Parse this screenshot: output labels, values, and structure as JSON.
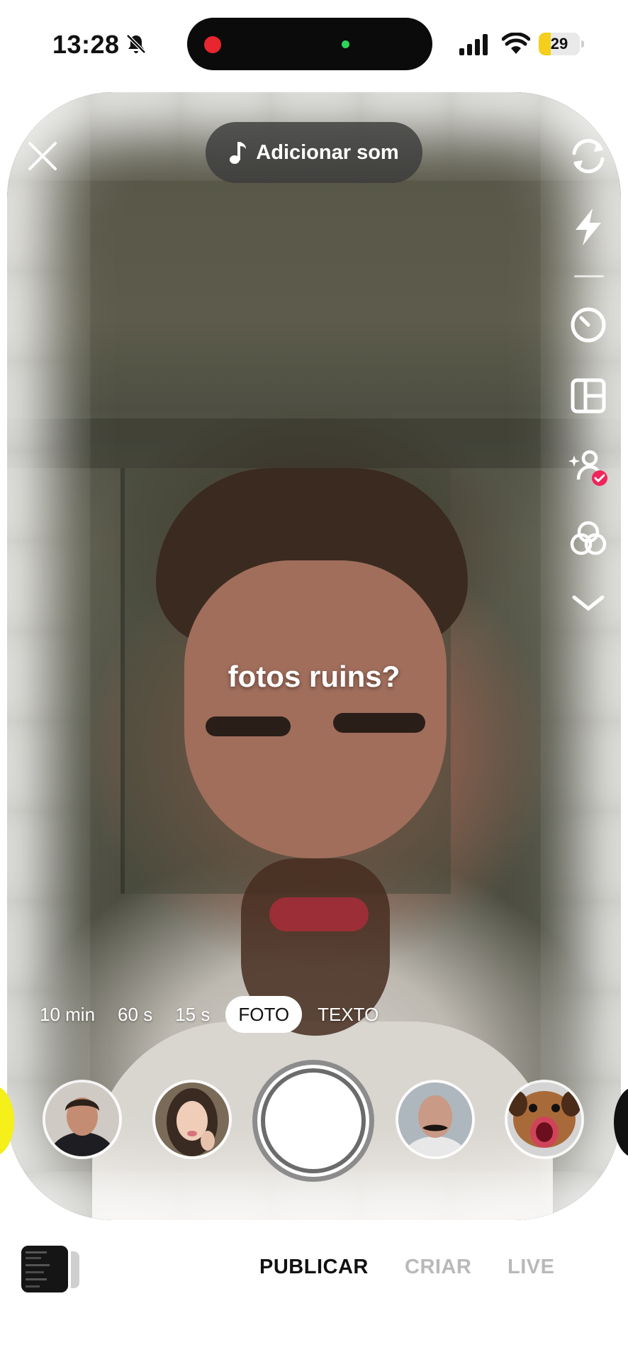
{
  "status_bar": {
    "time": "13:28",
    "battery_level": "29",
    "battery_fraction": 0.29,
    "icons": [
      "bell-slash-icon",
      "recording-dot",
      "camera-indicator",
      "signal-icon",
      "wifi-icon",
      "battery-icon"
    ]
  },
  "camera": {
    "add_sound_label": "Adicionar som",
    "overlay_caption": "fotos ruins?",
    "right_rail_icons": [
      "flip-camera-icon",
      "flash-icon",
      "timer-icon",
      "layout-icon",
      "beautify-icon",
      "filters-icon",
      "chevron-down-icon"
    ]
  },
  "modes": {
    "items": [
      "10 min",
      "60 s",
      "15 s",
      "FOTO",
      "TEXTO"
    ],
    "selected": "FOTO"
  },
  "effects": [
    "effect-man-portrait",
    "effect-woman-portrait",
    "effect-bald-mustache",
    "effect-dog-face"
  ],
  "bottom_nav": {
    "tabs": [
      "PUBLICAR",
      "CRIAR",
      "LIVE"
    ],
    "active": "PUBLICAR"
  },
  "colors": {
    "accent_red": "#e8262f",
    "battery_yellow": "#f4cf1b",
    "checkmark_badge": "#f0245a"
  }
}
